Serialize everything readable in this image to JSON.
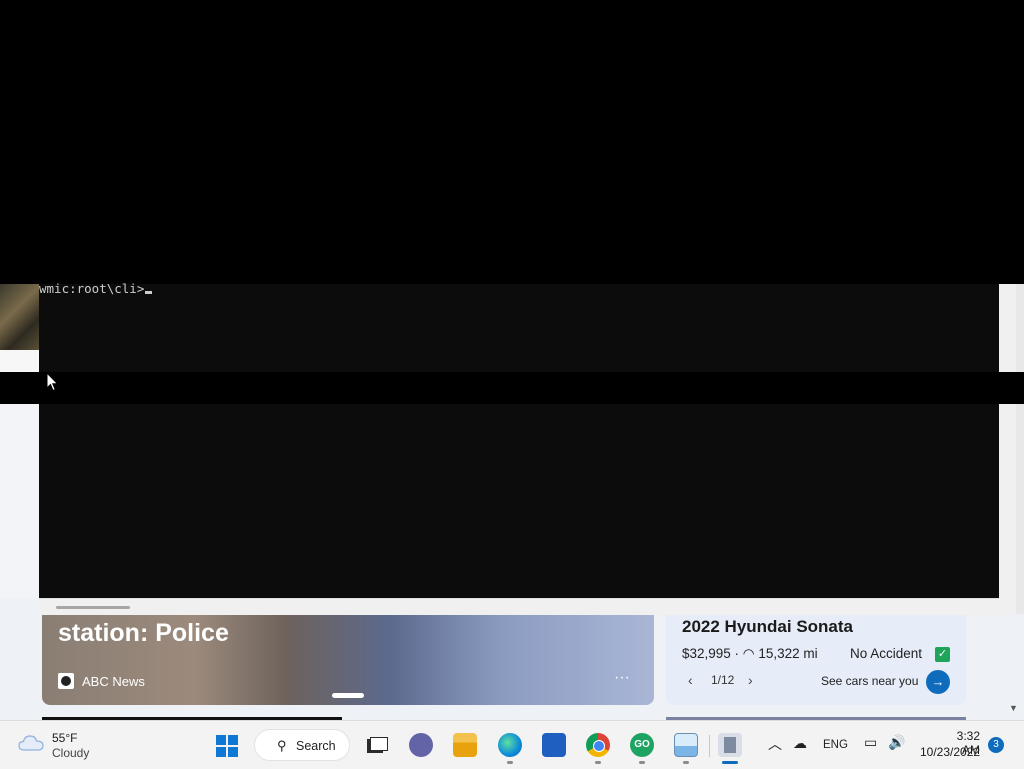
{
  "console": {
    "prompt": "wmic:root\\cli>"
  },
  "news": {
    "headline": "station: Police",
    "source": "ABC News",
    "more": "···"
  },
  "car_ad": {
    "title": "2022 Hyundai Sonata",
    "price": "$32,995 · ",
    "mileage": "15,322 mi",
    "badge": "No Accident",
    "pager": "1/12",
    "cta": "See cars near you"
  },
  "taskbar": {
    "weather_temp": "55°F",
    "weather_desc": "Cloudy",
    "search_label": "Search",
    "go_label": "GO",
    "language": "ENG",
    "time": "3:32 AM",
    "date": "10/23/2022",
    "notification_count": "3"
  },
  "colors": {
    "accent": "#0f6cbd",
    "console_bg": "#0c0c0c"
  }
}
